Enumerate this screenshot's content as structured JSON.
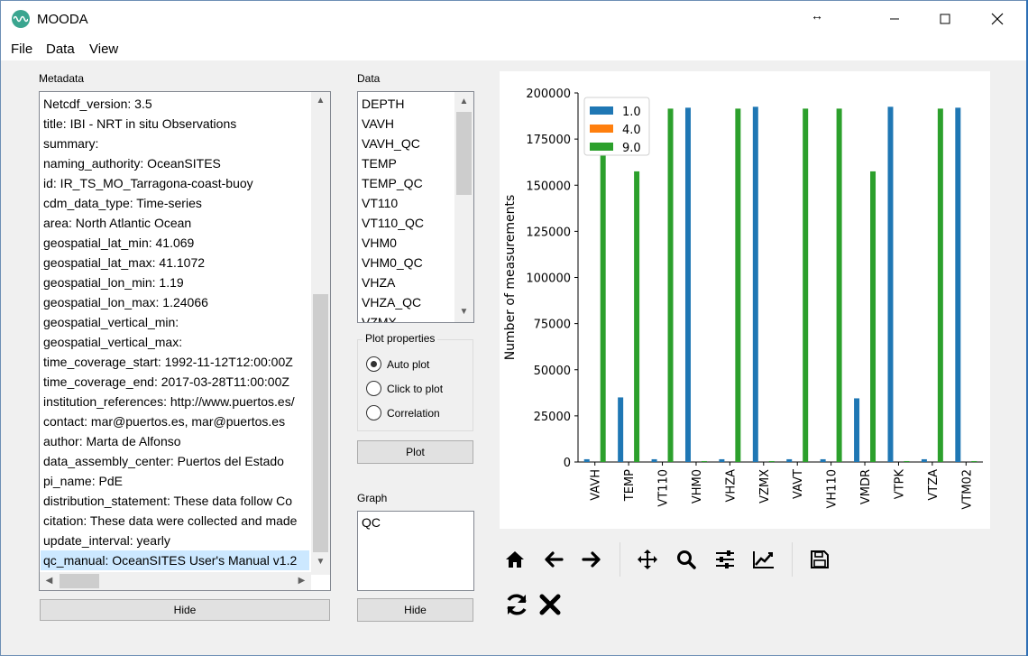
{
  "window": {
    "title": "MOODA",
    "resize_icon": "↔",
    "minimize_icon": "minimize-icon",
    "maximize_icon": "maximize-icon",
    "close_icon": "close-icon"
  },
  "menu": {
    "file": "File",
    "data": "Data",
    "view": "View"
  },
  "metadata": {
    "label": "Metadata",
    "lines": [
      "Netcdf_version: 3.5",
      "title: IBI - NRT in situ Observations",
      "summary:",
      "naming_authority: OceanSITES",
      "id: IR_TS_MO_Tarragona-coast-buoy",
      "cdm_data_type: Time-series",
      "area: North Atlantic Ocean",
      "geospatial_lat_min: 41.069",
      "geospatial_lat_max: 41.1072",
      "geospatial_lon_min: 1.19",
      "geospatial_lon_max: 1.24066",
      "geospatial_vertical_min:",
      "geospatial_vertical_max:",
      "time_coverage_start: 1992-11-12T12:00:00Z",
      "time_coverage_end: 2017-03-28T11:00:00Z",
      "institution_references: http://www.puertos.es/",
      "contact: mar@puertos.es, mar@puertos.es",
      "author: Marta de Alfonso",
      "data_assembly_center: Puertos del Estado",
      "pi_name: PdE",
      "distribution_statement: These data follow Co",
      "citation: These data were collected and made",
      "update_interval: yearly",
      "qc_manual: OceanSITES User's Manual v1.2"
    ],
    "selected_index": 23,
    "hide_label": "Hide"
  },
  "data_panel": {
    "label": "Data",
    "items": [
      "DEPTH",
      "VAVH",
      "VAVH_QC",
      "TEMP",
      "TEMP_QC",
      "VT110",
      "VT110_QC",
      "VHM0",
      "VHM0_QC",
      "VHZA",
      "VHZA_QC",
      "VZMX"
    ]
  },
  "plot_properties": {
    "title": "Plot properties",
    "options": [
      "Auto plot",
      "Click to plot",
      "Correlation"
    ],
    "selected": 0,
    "plot_button": "Plot"
  },
  "graph": {
    "label": "Graph",
    "items": [
      "QC"
    ],
    "hide_label": "Hide"
  },
  "toolbar": {
    "icons": [
      "home-icon",
      "back-arrow-icon",
      "forward-arrow-icon",
      "pan-icon",
      "zoom-icon",
      "configure-subplots-icon",
      "edit-axes-icon",
      "save-icon",
      "refresh-icon",
      "clear-icon"
    ]
  },
  "colors": {
    "series_1": "#1f77b4",
    "series_4": "#ff7f0e",
    "series_9": "#2ca02c"
  },
  "chart_data": {
    "type": "bar",
    "categories": [
      "VAVH",
      "TEMP",
      "VT110",
      "VHM0",
      "VHZA",
      "VZMX",
      "VAVT",
      "VH110",
      "VMDR",
      "VTPK",
      "VTZA",
      "VTM02"
    ],
    "series": [
      {
        "name": "1.0",
        "values": [
          1500,
          35000,
          1500,
          192000,
          1500,
          192500,
          1500,
          1500,
          34500,
          192500,
          1500,
          192000
        ]
      },
      {
        "name": "4.0",
        "values": [
          0,
          0,
          0,
          0,
          0,
          0,
          0,
          0,
          0,
          0,
          0,
          0
        ]
      },
      {
        "name": "9.0",
        "values": [
          192000,
          157500,
          191500,
          500,
          191500,
          500,
          191500,
          191500,
          157500,
          500,
          191500,
          500
        ]
      }
    ],
    "title": "",
    "xlabel": "",
    "ylabel": "Number of measurements",
    "ylim": [
      0,
      200000
    ],
    "yticks": [
      "0",
      "25000",
      "50000",
      "75000",
      "100000",
      "125000",
      "150000",
      "175000",
      "200000"
    ],
    "legend_position": "top-left",
    "grid": false
  }
}
